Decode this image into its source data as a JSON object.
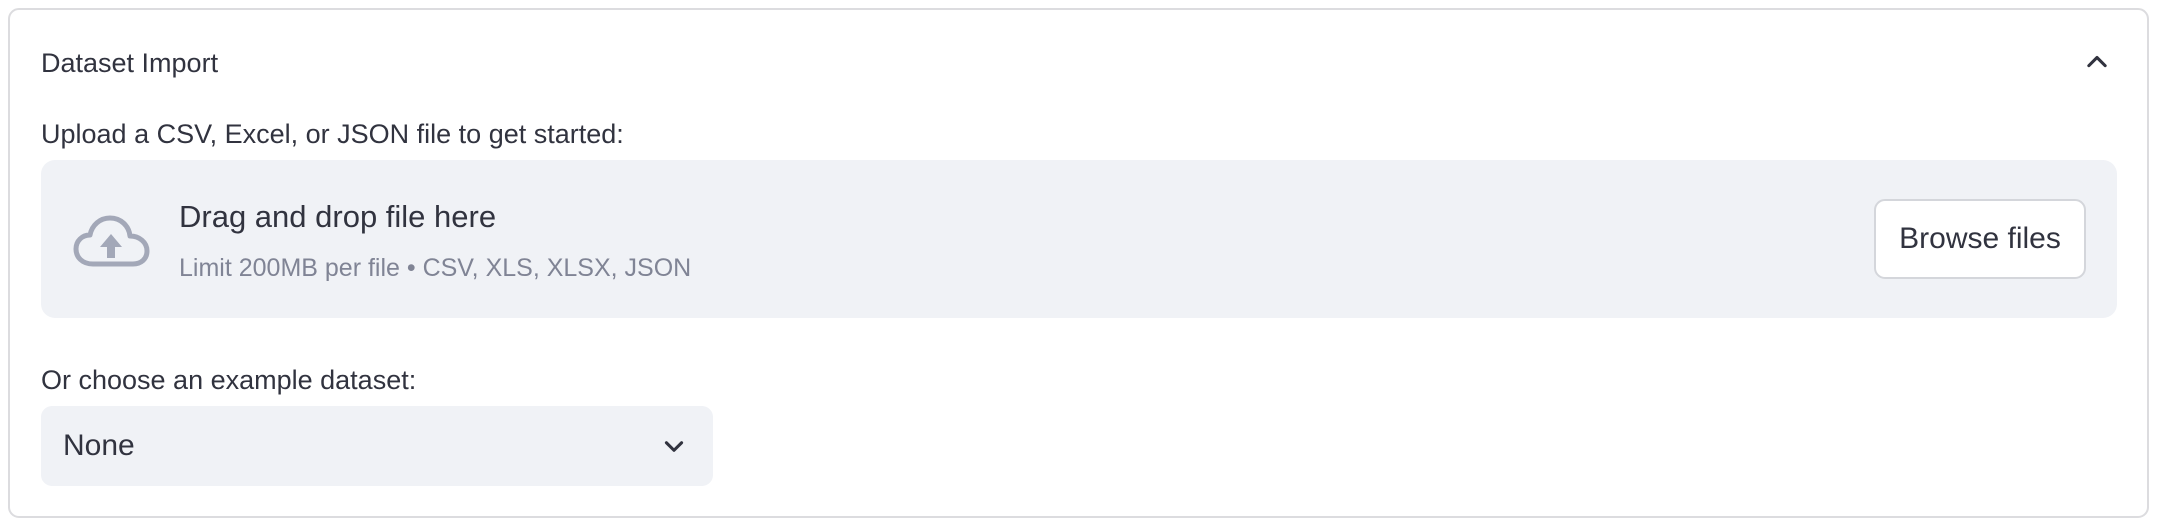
{
  "expander": {
    "title": "Dataset Import",
    "expanded": true,
    "toggle_icon": "chevron-up-icon"
  },
  "uploader": {
    "label": "Upload a CSV, Excel, or JSON file to get started:",
    "icon": "cloud-upload-icon",
    "drop_text": "Drag and drop file here",
    "limit_text": "Limit 200MB per file • CSV, XLS, XLSX, JSON",
    "browse_label": "Browse files"
  },
  "example_select": {
    "label": "Or choose an example dataset:",
    "selected": "None",
    "icon": "chevron-down-icon"
  },
  "colors": {
    "text": "#31333f",
    "muted_text": "#808495",
    "panel_bg": "#f0f2f6",
    "border": "#dcdcdf",
    "icon": "#a3a8b8"
  }
}
